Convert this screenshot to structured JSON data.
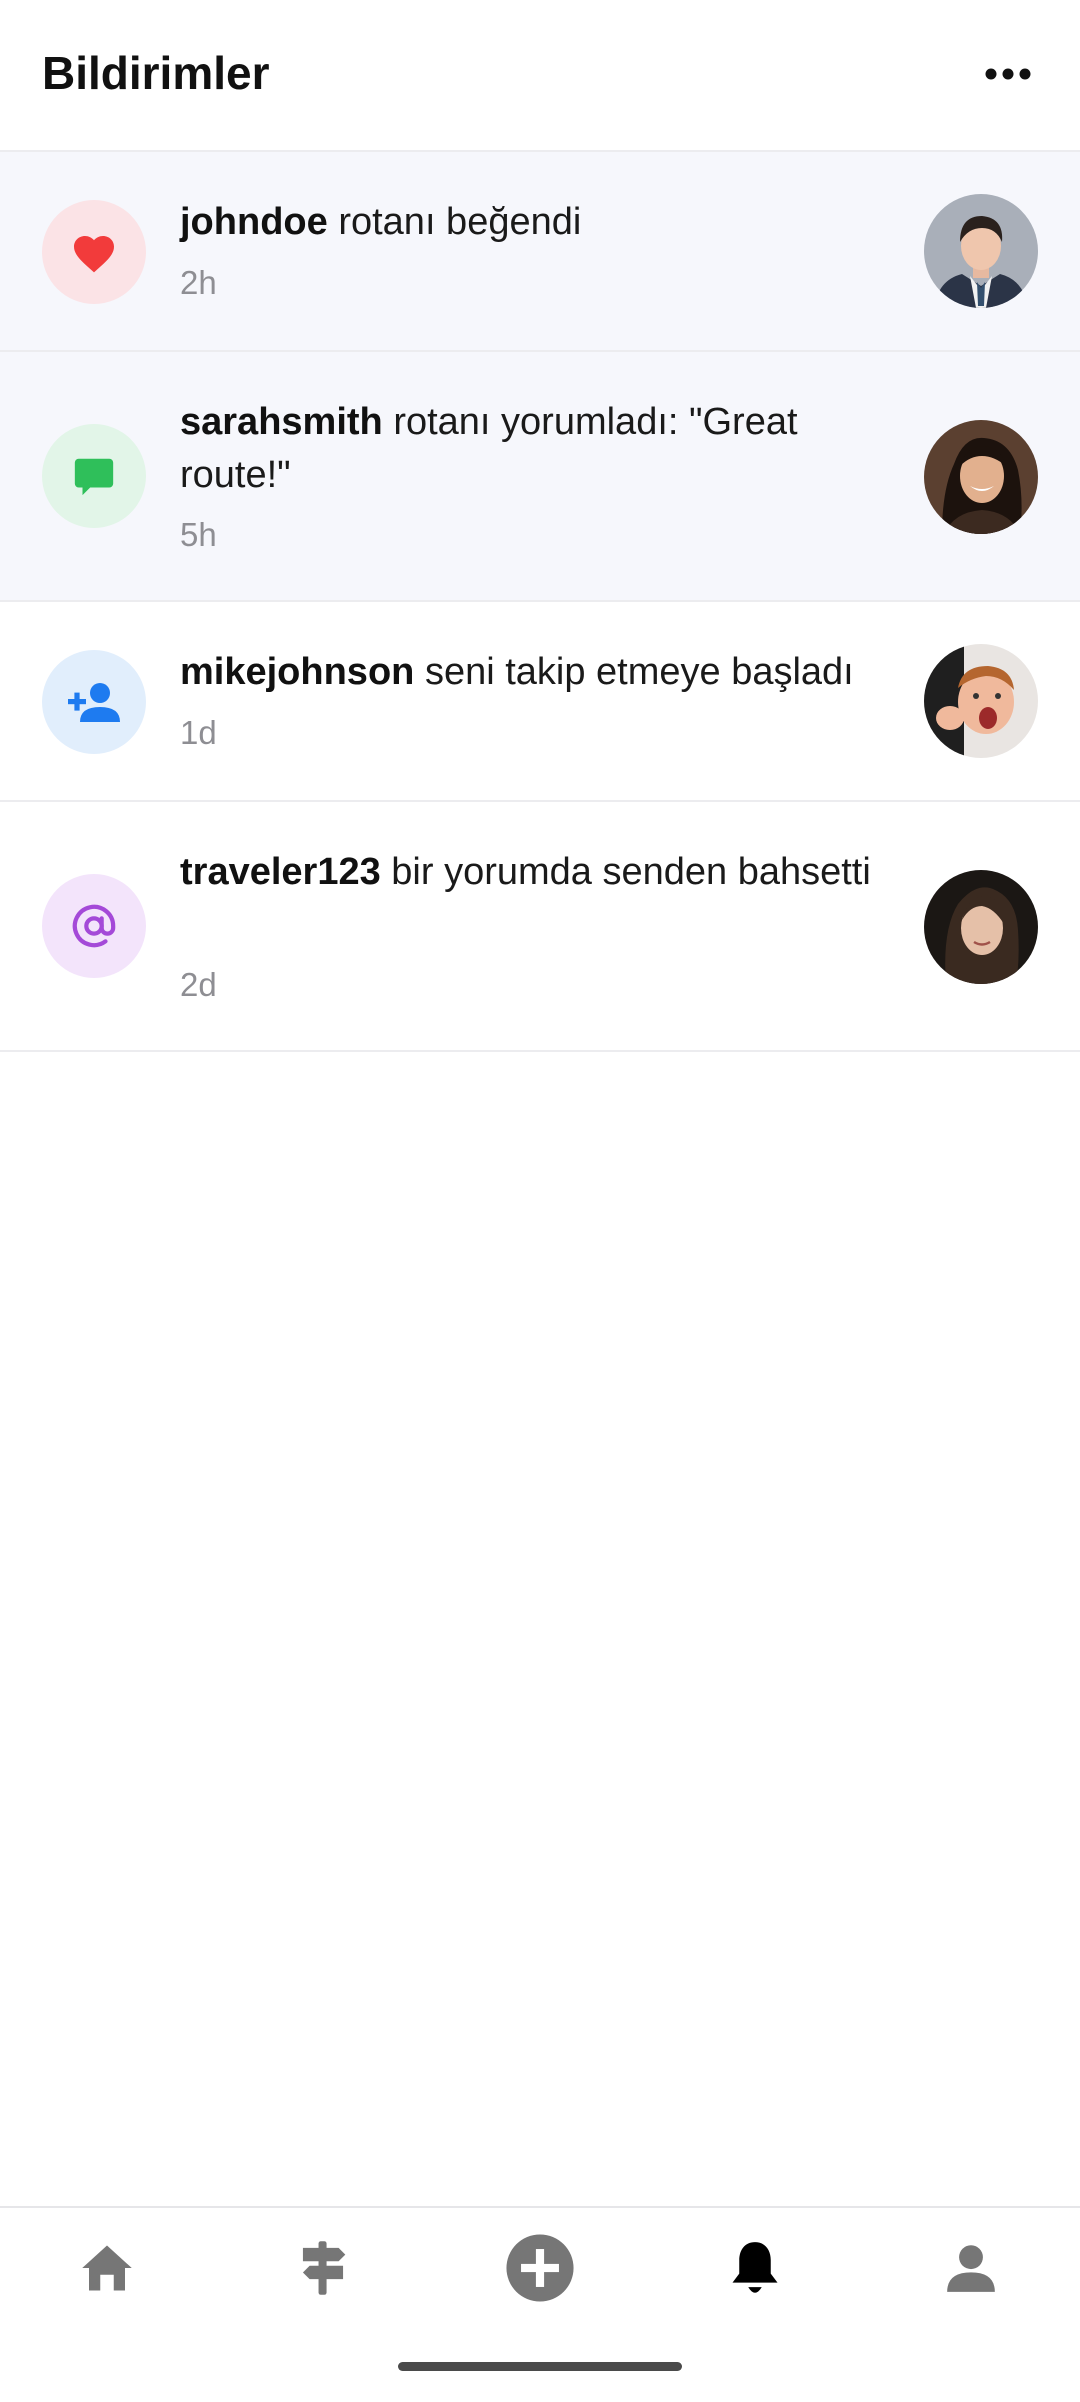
{
  "header": {
    "title": "Bildirimler",
    "more_icon": "more-horizontal-icon"
  },
  "notifications": [
    {
      "username": "johndoe",
      "text": "rotanı beğendi",
      "time": "2h",
      "icon": "heart-icon",
      "icon_color": "#f23b3b",
      "icon_bg": "#fbe3e6",
      "unread": true
    },
    {
      "username": "sarahsmith",
      "text": "rotanı yorumladı: \"Great route!\"",
      "time": "5h",
      "icon": "comment-icon",
      "icon_color": "#2fbf5a",
      "icon_bg": "#e2f5e8",
      "unread": true
    },
    {
      "username": "mikejohnson",
      "text": "seni takip etmeye başladı",
      "time": "1d",
      "icon": "person-add-icon",
      "icon_color": "#1e7bf0",
      "icon_bg": "#e1eefc",
      "unread": false
    },
    {
      "username": "traveler123",
      "text": "bir yorumda senden bahsetti",
      "time": "2d",
      "icon": "at-sign-icon",
      "icon_color": "#a449d8",
      "icon_bg": "#f3e4fb",
      "unread": false
    }
  ],
  "tabbar": {
    "tabs": [
      {
        "icon": "home-icon",
        "active": false
      },
      {
        "icon": "signpost-icon",
        "active": false
      },
      {
        "icon": "add-circle-icon",
        "active": false
      },
      {
        "icon": "bell-icon",
        "active": true
      },
      {
        "icon": "profile-icon",
        "active": false
      }
    ],
    "active_color": "#000000",
    "inactive_color": "#767676"
  }
}
